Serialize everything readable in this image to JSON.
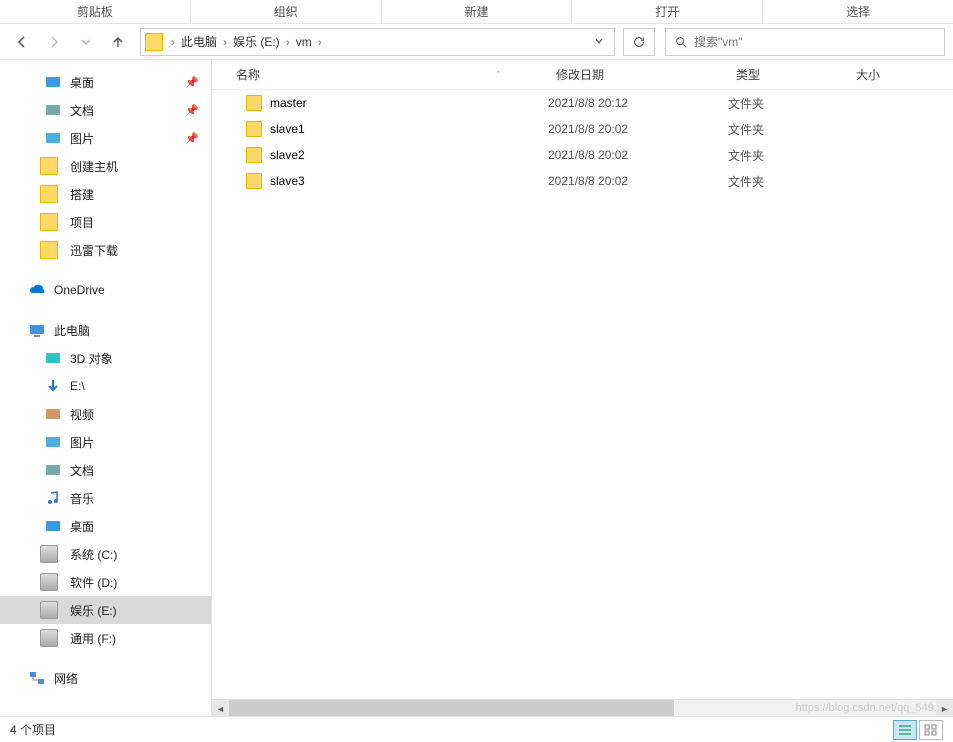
{
  "ribbon": [
    "剪贴板",
    "组织",
    "新建",
    "打开",
    "选择"
  ],
  "breadcrumbs": [
    "此电脑",
    "娱乐 (E:)",
    "vm"
  ],
  "search": {
    "placeholder": "搜索\"vm\""
  },
  "columns": {
    "name": "名称",
    "date": "修改日期",
    "type": "类型",
    "size": "大小"
  },
  "files": [
    {
      "name": "master",
      "date": "2021/8/8 20:12",
      "type": "文件夹"
    },
    {
      "name": "slave1",
      "date": "2021/8/8 20:02",
      "type": "文件夹"
    },
    {
      "name": "slave2",
      "date": "2021/8/8 20:02",
      "type": "文件夹"
    },
    {
      "name": "slave3",
      "date": "2021/8/8 20:02",
      "type": "文件夹"
    }
  ],
  "sidebar": {
    "quick": [
      {
        "label": "桌面",
        "icon": "desktop",
        "pinned": true
      },
      {
        "label": "文档",
        "icon": "doc",
        "pinned": true
      },
      {
        "label": "图片",
        "icon": "pic",
        "pinned": true
      },
      {
        "label": "创建主机",
        "icon": "folder"
      },
      {
        "label": "搭建",
        "icon": "folder"
      },
      {
        "label": "项目",
        "icon": "folder"
      },
      {
        "label": "迅雷下载",
        "icon": "folder"
      }
    ],
    "onedrive": "OneDrive",
    "thispc_label": "此电脑",
    "thispc": [
      {
        "label": "3D 对象",
        "icon": "3d"
      },
      {
        "label": "E:\\",
        "icon": "down"
      },
      {
        "label": "视频",
        "icon": "video"
      },
      {
        "label": "图片",
        "icon": "pic"
      },
      {
        "label": "文档",
        "icon": "doc"
      },
      {
        "label": "音乐",
        "icon": "music"
      },
      {
        "label": "桌面",
        "icon": "desktop"
      },
      {
        "label": "系统 (C:)",
        "icon": "drive-c"
      },
      {
        "label": "软件 (D:)",
        "icon": "drive"
      },
      {
        "label": "娱乐 (E:)",
        "icon": "drive",
        "selected": true
      },
      {
        "label": "通用 (F:)",
        "icon": "drive"
      }
    ],
    "network": "网络"
  },
  "status": "4 个项目",
  "watermark": "https://blog.csdn.net/qq_549..."
}
